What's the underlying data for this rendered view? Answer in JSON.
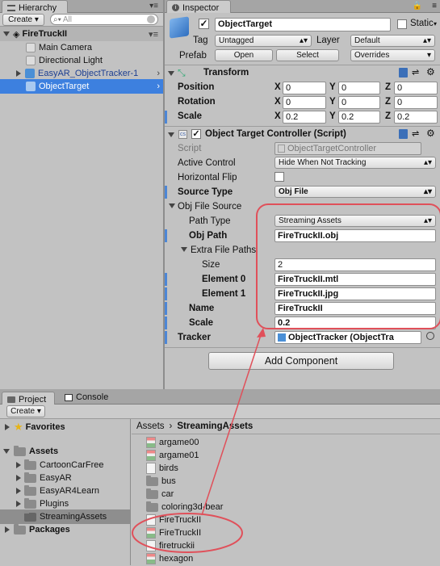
{
  "hierarchy": {
    "tab_label": "Hierarchy",
    "create_label": "Create",
    "search_placeholder": "All",
    "scene_name": "FireTruckII",
    "items": [
      {
        "label": "Main Camera"
      },
      {
        "label": "Directional Light"
      },
      {
        "label": "EasyAR_ObjectTracker-1"
      },
      {
        "label": "ObjectTarget"
      }
    ]
  },
  "inspector": {
    "tab_label": "Inspector",
    "object_name": "ObjectTarget",
    "static_label": "Static",
    "tag_label": "Tag",
    "tag_value": "Untagged",
    "layer_label": "Layer",
    "layer_value": "Default",
    "prefab_label": "Prefab",
    "prefab_open": "Open",
    "prefab_select": "Select",
    "prefab_overrides": "Overrides",
    "transform": {
      "title": "Transform",
      "rows": [
        {
          "label": "Position",
          "x": "0",
          "y": "0",
          "z": "0"
        },
        {
          "label": "Rotation",
          "x": "0",
          "y": "0",
          "z": "0"
        },
        {
          "label": "Scale",
          "x": "0.2",
          "y": "0.2",
          "z": "0.2"
        }
      ],
      "axis_x": "X",
      "axis_y": "Y",
      "axis_z": "Z"
    },
    "controller": {
      "title": "Object Target Controller (Script)",
      "script_label": "Script",
      "script_value": "ObjectTargetController",
      "active_control_label": "Active Control",
      "active_control_value": "Hide When Not Tracking",
      "horizontal_flip_label": "Horizontal Flip",
      "source_type_label": "Source Type",
      "source_type_value": "Obj File",
      "obj_file_source_label": "Obj File Source",
      "path_type_label": "Path Type",
      "path_type_value": "Streaming Assets",
      "obj_path_label": "Obj Path",
      "obj_path_value": "FireTruckII.obj",
      "extra_paths_label": "Extra File Paths",
      "size_label": "Size",
      "size_value": "2",
      "element0_label": "Element 0",
      "element0_value": "FireTruckII.mtl",
      "element1_label": "Element 1",
      "element1_value": "FireTruckII.jpg",
      "name_label": "Name",
      "name_value": "FireTruckII",
      "scale_label": "Scale",
      "scale_value": "0.2",
      "tracker_label": "Tracker",
      "tracker_value": "ObjectTracker (ObjectTra"
    },
    "add_component": "Add Component"
  },
  "project": {
    "tab_project": "Project",
    "tab_console": "Console",
    "create_label": "Create",
    "favorites": "Favorites",
    "assets": "Assets",
    "folders": [
      "CartoonCarFree",
      "EasyAR",
      "EasyAR4Learn",
      "Plugins",
      "StreamingAssets"
    ],
    "packages": "Packages",
    "breadcrumb_root": "Assets",
    "breadcrumb_current": "StreamingAssets",
    "files": [
      "argame00",
      "argame01",
      "birds",
      "bus",
      "car",
      "coloring3d-bear",
      "FireTruckII",
      "FireTruckII",
      "firetruckii",
      "hexagon"
    ]
  },
  "colors": {
    "selection": "#3d80df",
    "annotation": "#e0505a",
    "object_icon": "#4a8fd6"
  }
}
